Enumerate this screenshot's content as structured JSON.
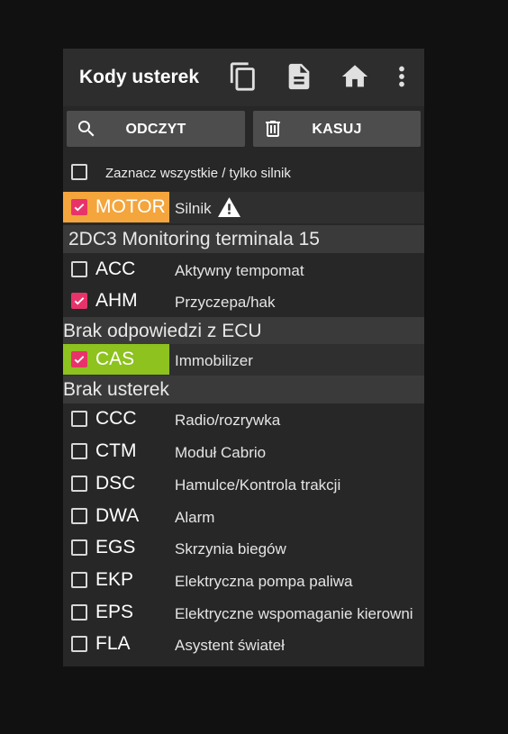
{
  "toolbar": {
    "title": "Kody usterek",
    "icons": [
      "copy-icon",
      "document-icon",
      "home-icon",
      "more-vert-icon"
    ]
  },
  "actions": {
    "read_label": "ODCZYT",
    "read_icon": "search-icon",
    "delete_label": "KASUJ",
    "delete_icon": "trash-icon"
  },
  "select_all": {
    "label": "Zaznacz wszystkie / tylko silnik",
    "checked": false
  },
  "colors": {
    "checkbox_checked": "#e8336a",
    "motor_highlight": "#f4a53c",
    "cas_highlight": "#8dc21f"
  },
  "list": {
    "motor": {
      "code": "MOTOR",
      "desc": "Silnik",
      "checked": true,
      "warning_icon": "warning-icon"
    },
    "section1": "2DC3 Monitoring terminala 15",
    "acc": {
      "code": "ACC",
      "desc": "Aktywny tempomat",
      "checked": false
    },
    "ahm": {
      "code": "AHM",
      "desc": "Przyczepa/hak",
      "checked": true
    },
    "section2": "Brak odpowiedzi z ECU",
    "cas": {
      "code": "CAS",
      "desc": "Immobilizer",
      "checked": true
    },
    "section3": "Brak usterek",
    "modules": [
      {
        "code": "CCC",
        "desc": "Radio/rozrywka",
        "checked": false
      },
      {
        "code": "CTM",
        "desc": "Moduł Cabrio",
        "checked": false
      },
      {
        "code": "DSC",
        "desc": "Hamulce/Kontrola trakcji",
        "checked": false
      },
      {
        "code": "DWA",
        "desc": "Alarm",
        "checked": false
      },
      {
        "code": "EGS",
        "desc": "Skrzynia biegów",
        "checked": false
      },
      {
        "code": "EKP",
        "desc": "Elektryczna pompa paliwa",
        "checked": false
      },
      {
        "code": "EPS",
        "desc": "Elektryczne wspomaganie kierowni",
        "checked": false
      },
      {
        "code": "FLA",
        "desc": "Asystent świateł",
        "checked": false
      }
    ]
  }
}
